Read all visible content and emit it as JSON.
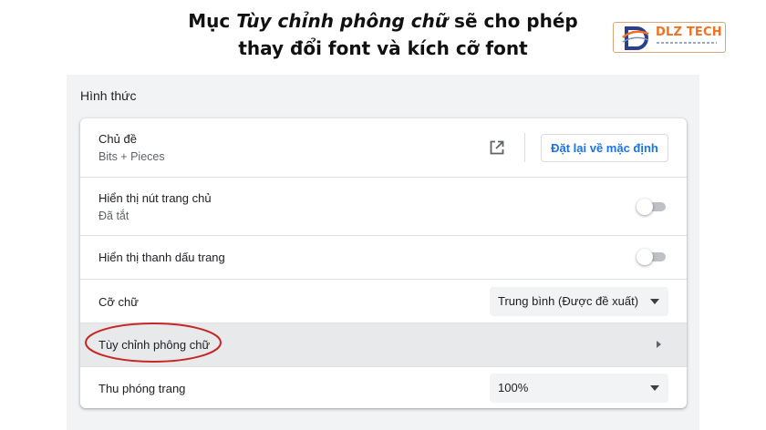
{
  "caption": {
    "line1_prefix": "Mục ",
    "line1_em": "Tùy chỉnh phông chữ",
    "line1_suffix": " sẽ cho phép",
    "line2": "thay đổi font và kích cỡ font"
  },
  "logo": {
    "text": "DLZ TECH",
    "brand_color": "#f37021"
  },
  "appearance": {
    "section_title": "Hình thức",
    "theme": {
      "label": "Chủ đề",
      "value": "Bits + Pieces",
      "open_icon": "open-in-new-icon",
      "reset_button": "Đặt lại về mặc định"
    },
    "home_button": {
      "label": "Hiển thị nút trang chủ",
      "value": "Đã tắt",
      "enabled": false
    },
    "bookmarks_bar": {
      "label": "Hiển thị thanh dấu trang",
      "enabled": false
    },
    "font_size": {
      "label": "Cỡ chữ",
      "selected": "Trung bình (Được đề xuất)"
    },
    "customize_fonts": {
      "label": "Tùy chỉnh phông chữ",
      "icon": "chevron-right-icon"
    },
    "page_zoom": {
      "label": "Thu phóng trang",
      "selected": "100%"
    }
  },
  "colors": {
    "accent": "#1a73e8",
    "annotation": "#c62828",
    "panel_bg": "#f1f3f4",
    "highlight_row": "#e8e9eb"
  }
}
